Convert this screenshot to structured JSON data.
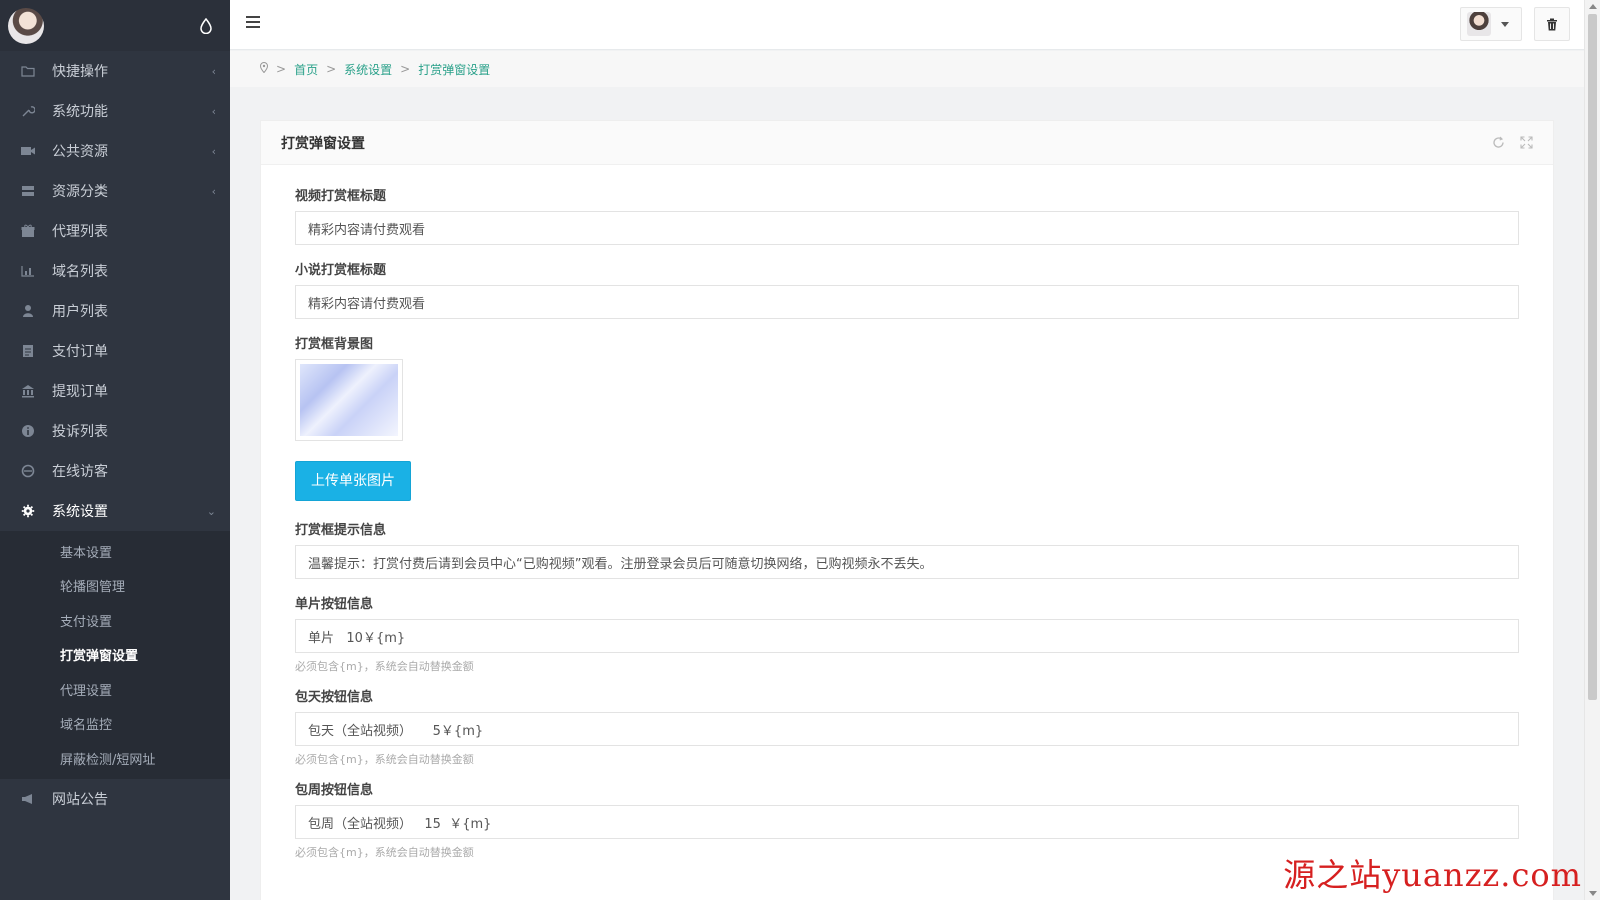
{
  "sidebar": {
    "items": [
      {
        "label": "快捷操作",
        "icon": "folder-icon",
        "has_children": true
      },
      {
        "label": "系统功能",
        "icon": "wrench-icon",
        "has_children": true
      },
      {
        "label": "公共资源",
        "icon": "video-camera-icon",
        "has_children": true
      },
      {
        "label": "资源分类",
        "icon": "list-icon",
        "has_children": true
      },
      {
        "label": "代理列表",
        "icon": "gift-icon",
        "has_children": false
      },
      {
        "label": "域名列表",
        "icon": "bar-chart-icon",
        "has_children": false
      },
      {
        "label": "用户列表",
        "icon": "user-icon",
        "has_children": false
      },
      {
        "label": "支付订单",
        "icon": "document-icon",
        "has_children": false
      },
      {
        "label": "提现订单",
        "icon": "bank-icon",
        "has_children": false
      },
      {
        "label": "投诉列表",
        "icon": "info-icon",
        "has_children": false
      },
      {
        "label": "在线访客",
        "icon": "globe-icon",
        "has_children": false
      },
      {
        "label": "系统设置",
        "icon": "gear-icon",
        "has_children": true,
        "expanded": true
      },
      {
        "label": "网站公告",
        "icon": "bullhorn-icon",
        "has_children": false
      }
    ],
    "system_settings_sub": [
      {
        "label": "基本设置"
      },
      {
        "label": "轮播图管理"
      },
      {
        "label": "支付设置"
      },
      {
        "label": "打赏弹窗设置",
        "current": true
      },
      {
        "label": "代理设置"
      },
      {
        "label": "域名监控"
      },
      {
        "label": "屏蔽检测/短网址"
      }
    ]
  },
  "breadcrumb": {
    "items": [
      "首页",
      "系统设置",
      "打赏弹窗设置"
    ],
    "separator": ">"
  },
  "card": {
    "title": "打赏弹窗设置"
  },
  "form": {
    "video_title_label": "视频打赏框标题",
    "video_title_value": "精彩内容请付费观看",
    "novel_title_label": "小说打赏框标题",
    "novel_title_value": "精彩内容请付费观看",
    "background_label": "打赏框背景图",
    "upload_button": "上传单张图片",
    "tip_label": "打赏框提示信息",
    "tip_value": "温馨提示：打赏付费后请到会员中心“已购视频”观看。注册登录会员后可随意切换网络，已购视频永不丢失。",
    "single_label": "单片按钮信息",
    "single_value": "单片   10￥{m}",
    "single_hint": "必须包含{m}，系统会自动替换金额",
    "day_label": "包天按钮信息",
    "day_value": "包天（全站视频）     5￥{m}",
    "day_hint": "必须包含{m}，系统会自动替换金额",
    "week_label": "包周按钮信息",
    "week_value": "包周（全站视频）   15  ￥{m}",
    "week_hint": "必须包含{m}，系统会自动替换金额"
  },
  "watermark": "源之站yuanzz.com",
  "colors": {
    "sidebar_bg": "#2f3540",
    "link_green": "#2aa18a",
    "upload_blue": "#1ab1e5",
    "watermark_red": "#d62020"
  }
}
